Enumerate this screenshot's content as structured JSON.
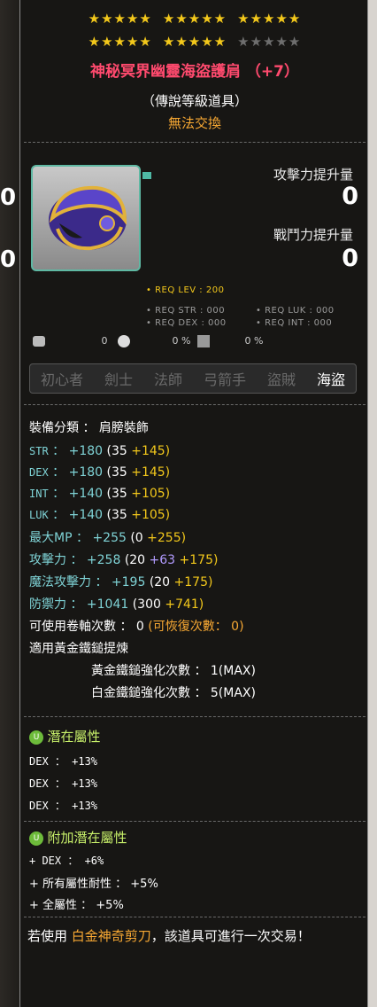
{
  "left_numbers": [
    "0",
    "0"
  ],
  "stars": {
    "filled_first_row": 15,
    "filled_second_row": 10,
    "total_per_row": 15
  },
  "item": {
    "name": "神秘冥界幽靈海盜護肩 （+7）",
    "grade": "（傳說等級道具）",
    "trade": "無法交換"
  },
  "stats_up": {
    "attack_label": "攻擊力提升量",
    "attack_value": "0",
    "combat_label": "戰鬥力提升量",
    "combat_value": "0"
  },
  "req": {
    "lev": "• REQ LEV : 200",
    "str": "• REQ STR : 000",
    "luk": "• REQ LUK : 000",
    "dex": "• REQ DEX : 000",
    "int": "• REQ INT : 000"
  },
  "small_icons": {
    "a": "0",
    "b": "0 %",
    "c": "0 %"
  },
  "jobs": [
    "初心者",
    "劍士",
    "法師",
    "弓箭手",
    "盜賊",
    "海盜"
  ],
  "equip": {
    "category": "裝備分類 ： 肩膀裝飾",
    "str": {
      "label": "STR",
      "total": "+180",
      "base": "(35",
      "bonus": "+145)"
    },
    "dex": {
      "label": "DEX",
      "total": "+180",
      "base": "(35",
      "bonus": "+145)"
    },
    "int": {
      "label": "INT",
      "total": "+140",
      "base": "(35",
      "bonus": "+105)"
    },
    "luk": {
      "label": "LUK",
      "total": "+140",
      "base": "(35",
      "bonus": "+105)"
    },
    "mp": {
      "label": "最大MP",
      "total": "+255",
      "base": "(0",
      "bonus": "+255)"
    },
    "atk": {
      "label": "攻擊力",
      "total": "+258",
      "base": "(20",
      "mid": "+63",
      "bonus": "+175)"
    },
    "matk": {
      "label": "魔法攻擊力",
      "total": "+195",
      "base": "(20",
      "bonus": "+175)"
    },
    "def": {
      "label": "防禦力",
      "total": "+1041",
      "base": "(300",
      "bonus": "+741)"
    },
    "scroll": "可使用卷軸次數 ： 0",
    "scroll_restore": "(可恢復次數： 0)",
    "hammer": "適用黃金鐵鎚提煉",
    "gold_hammer": "黃金鐵鎚強化次數 ： 1(MAX)",
    "plat_hammer": "白金鐵鎚強化次數 ： 5(MAX)"
  },
  "potential": {
    "badge": "U",
    "title": "潛在屬性",
    "lines": [
      "DEX ： +13%",
      "DEX ： +13%",
      "DEX ： +13%"
    ]
  },
  "bonus_potential": {
    "badge": "U",
    "title": "附加潛在屬性",
    "lines": [
      "+ DEX ： +6%",
      "+ 所有屬性耐性 ： +5%",
      "+ 全屬性 ： +5%"
    ]
  },
  "footer": {
    "prefix": "若使用 ",
    "item": "白金神奇剪刀",
    "suffix": "，該道具可進行一次交易！"
  }
}
